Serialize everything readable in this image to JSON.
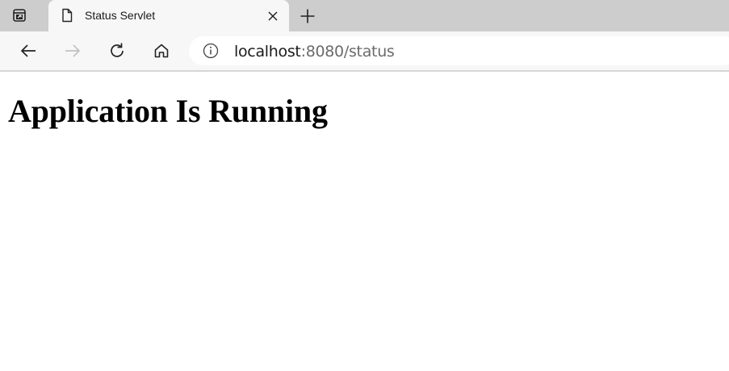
{
  "tab": {
    "title": "Status Servlet"
  },
  "address": {
    "host": "localhost",
    "rest": ":8080/status"
  },
  "page": {
    "heading": "Application Is Running"
  },
  "icons": {
    "tab_actions": "tab-actions-icon",
    "page": "document-icon",
    "close": "close-icon",
    "new_tab": "plus-icon",
    "back": "arrow-left-icon",
    "forward": "arrow-right-icon",
    "refresh": "refresh-icon",
    "home": "home-icon",
    "info": "info-icon"
  },
  "colors": {
    "tab_strip": "#cdcdcd",
    "toolbar": "#f7f7f7",
    "url_rest": "#6b6b6b"
  }
}
